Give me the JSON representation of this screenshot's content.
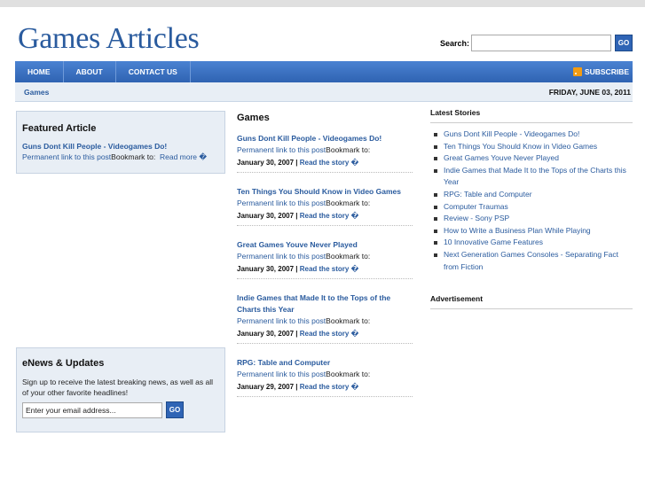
{
  "site": {
    "title": "Games Articles"
  },
  "search": {
    "label": "Search:",
    "value": "",
    "button": "GO"
  },
  "nav": {
    "items": [
      {
        "label": "HOME"
      },
      {
        "label": "ABOUT"
      },
      {
        "label": "CONTACT US"
      }
    ],
    "subscribe": "SUBSCRIBE"
  },
  "breadcrumb": {
    "current": "Games",
    "date": "FRIDAY, JUNE 03, 2011"
  },
  "featured": {
    "heading": "Featured Article",
    "title": "Guns Dont Kill People - Videogames Do!",
    "permalink": "Permanent link to this post",
    "bookmark": "Bookmark to:",
    "read_more": "Read more �"
  },
  "enews": {
    "heading": "eNews & Updates",
    "text": "Sign up to receive the latest breaking news, as well as all of your other favorite headlines!",
    "email_value": "Enter your email address...",
    "button": "GO"
  },
  "center": {
    "heading": "Games",
    "posts": [
      {
        "title": "Guns Dont Kill People - Videogames Do!",
        "permalink": "Permanent link to this post",
        "bookmark": "Bookmark to:",
        "date": "January 30, 2007",
        "sep": " | ",
        "read": "Read the story �"
      },
      {
        "title": "Ten Things You Should Know in Video Games",
        "permalink": "Permanent link to this post",
        "bookmark": "Bookmark to:",
        "date": "January 30, 2007",
        "sep": " | ",
        "read": "Read the story �"
      },
      {
        "title": "Great Games Youve Never Played",
        "permalink": "Permanent link to this post",
        "bookmark": "Bookmark to:",
        "date": "January 30, 2007",
        "sep": " | ",
        "read": "Read the story �"
      },
      {
        "title": "Indie Games that Made It to the Tops of the Charts this Year",
        "permalink": "Permanent link to this post",
        "bookmark": "Bookmark to:",
        "date": "January 30, 2007",
        "sep": " | ",
        "read": "Read the story �"
      },
      {
        "title": "RPG: Table and Computer",
        "permalink": "Permanent link to this post",
        "bookmark": "Bookmark to:",
        "date": "January 29, 2007",
        "sep": " | ",
        "read": "Read the story �"
      }
    ]
  },
  "sidebar": {
    "latest_heading": "Latest Stories",
    "stories": [
      "Guns Dont Kill People - Videogames Do!",
      "Ten Things You Should Know in Video Games",
      "Great Games Youve Never Played",
      "Indie Games that Made It to the Tops of the Charts this Year",
      "RPG: Table and Computer",
      "Computer Traumas",
      "Review - Sony PSP",
      "How to Write a Business Plan While Playing",
      "10 Innovative Game Features",
      "Next Generation Games Consoles - Separating Fact from Fiction"
    ],
    "advert_heading": "Advertisement"
  },
  "colors": {
    "brand": "#2a5b9e",
    "nav": "#3872c6",
    "panel": "#e8eef5"
  }
}
